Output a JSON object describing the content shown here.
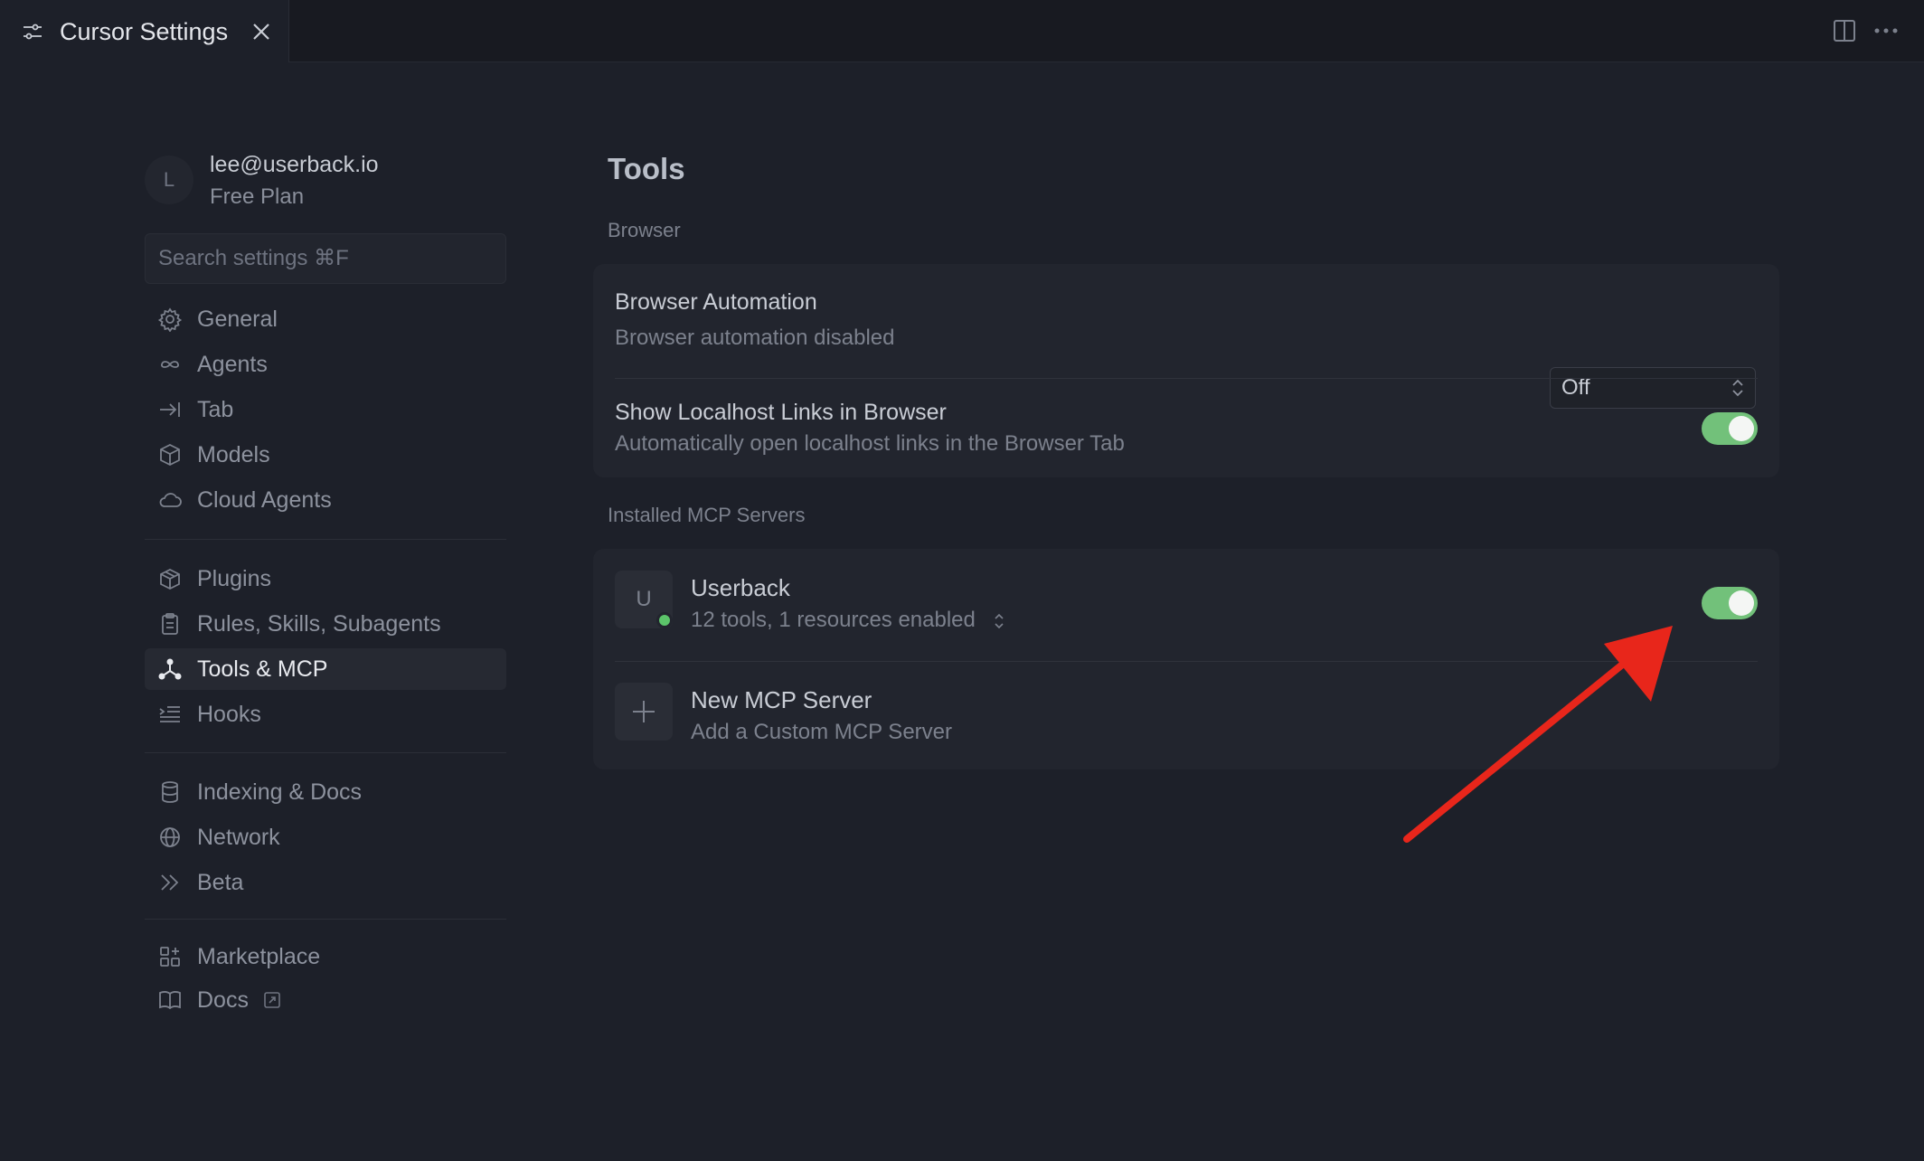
{
  "tab": {
    "title": "Cursor Settings"
  },
  "user": {
    "avatar_initial": "L",
    "email": "lee@userback.io",
    "plan": "Free Plan"
  },
  "search": {
    "placeholder": "Search settings ⌘F"
  },
  "sidebar": {
    "group1": [
      {
        "label": "General",
        "icon": "gear-icon"
      },
      {
        "label": "Agents",
        "icon": "infinity-icon"
      },
      {
        "label": "Tab",
        "icon": "arrow-to-line-icon"
      },
      {
        "label": "Models",
        "icon": "cube-icon"
      },
      {
        "label": "Cloud Agents",
        "icon": "cloud-icon"
      }
    ],
    "group2": [
      {
        "label": "Plugins",
        "icon": "package-icon"
      },
      {
        "label": "Rules, Skills, Subagents",
        "icon": "clipboard-icon"
      },
      {
        "label": "Tools & MCP",
        "icon": "nodes-icon",
        "active": true
      },
      {
        "label": "Hooks",
        "icon": "list-indent-icon"
      }
    ],
    "group3": [
      {
        "label": "Indexing & Docs",
        "icon": "database-icon"
      },
      {
        "label": "Network",
        "icon": "globe-icon"
      },
      {
        "label": "Beta",
        "icon": "double-chevron-icon"
      }
    ],
    "group4": [
      {
        "label": "Marketplace",
        "icon": "grid-plus-icon"
      },
      {
        "label": "Docs",
        "icon": "book-icon"
      }
    ]
  },
  "content": {
    "title": "Tools",
    "browser_section": "Browser",
    "browser_automation": {
      "title": "Browser Automation",
      "subtitle": "Browser automation disabled",
      "value": "Off"
    },
    "localhost_links": {
      "title": "Show Localhost Links in Browser",
      "subtitle": "Automatically open localhost links in the Browser Tab",
      "enabled": true
    },
    "mcp_section": "Installed MCP Servers",
    "server": {
      "initial": "U",
      "name": "Userback",
      "summary": "12 tools, 1 resources enabled",
      "enabled": true
    },
    "new_server": {
      "title": "New MCP Server",
      "subtitle": "Add a Custom MCP Server"
    }
  },
  "colors": {
    "toggle_on": "#72c17a",
    "status_dot": "#5cc46a",
    "annotation_arrow": "#e8261b"
  }
}
